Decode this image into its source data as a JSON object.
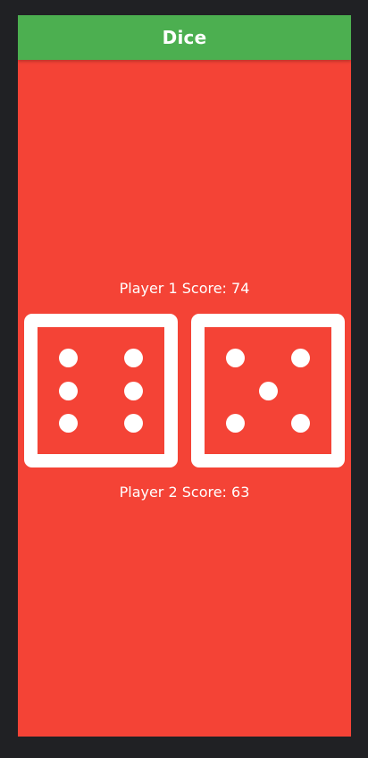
{
  "app": {
    "title": "Dice",
    "colors": {
      "app_bar": "#4caf50",
      "background": "#f44336",
      "die": "#ffffff",
      "frame": "#202124"
    }
  },
  "players": [
    {
      "score_label": "Player 1 Score: 74"
    },
    {
      "score_label": "Player 2 Score: 63"
    }
  ],
  "dice": [
    {
      "value": 6
    },
    {
      "value": 5
    }
  ]
}
